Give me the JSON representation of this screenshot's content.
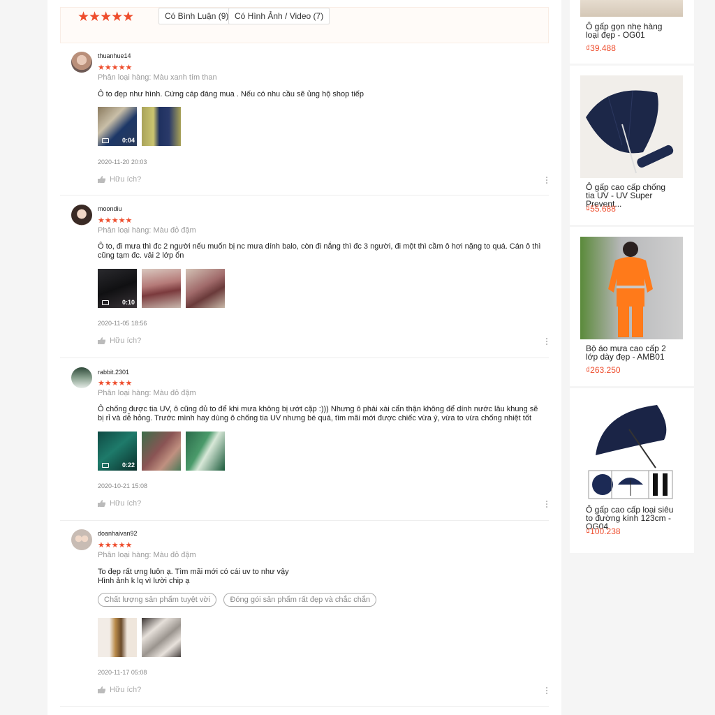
{
  "filters": {
    "stars": "★★★★★",
    "comments_label": "Có Bình Luận (9)",
    "media_label": "Có Hình Ảnh / Video (7)"
  },
  "reviews": [
    {
      "username": "thuanhue14",
      "stars": "★★★★★",
      "variation": "Phân loại hàng: Màu xanh tím than",
      "content": "Ô to đẹp như hình. Cứng cáp đáng mua . Nếu có nhu cầu sẽ ủng hộ shop tiếp",
      "video_duration": "0:04",
      "date": "2020-11-20 20:03",
      "helpful": "Hữu ích?"
    },
    {
      "username": "moondiu",
      "stars": "★★★★★",
      "variation": "Phân loại hàng: Màu đỏ đậm",
      "content": "Ô to, đi mưa thì đc 2 người nếu muốn bị nc mưa dính balo, còn đi nắng thì đc 3 người, đi một thì cầm ô hơi nặng to quá. Cán ô thì cũng tạm đc. vải 2 lớp ổn",
      "video_duration": "0:10",
      "date": "2020-11-05 18:56",
      "helpful": "Hữu ích?"
    },
    {
      "username": "rabbit.2301",
      "stars": "★★★★★",
      "variation": "Phân loại hàng: Màu đỏ đậm",
      "content": "Ô chống được tia UV, ô cũng đủ to để khi mưa không bị ướt cặp :))) Nhưng ô phải xài cẩn thận không để dính nước lâu khung sẽ bị rỉ và dễ hỏng. Trước mình hay dùng ô chống tia UV nhưng bé quá, tìm mãi mới được chiếc vừa ý, vừa to vừa chống nhiệt tốt",
      "video_duration": "0:22",
      "date": "2020-10-21 15:08",
      "helpful": "Hữu ích?"
    },
    {
      "username": "doanhaivan92",
      "stars": "★★★★★",
      "variation": "Phân loại hàng: Màu đỏ đậm",
      "content_line1": "To đẹp rất ưng luôn ạ. Tìm mãi mới có cái uv to như vậy",
      "content_line2": "Hình ảnh k lq vì lười chip ạ",
      "tag1": "Chất lượng sản phẩm tuyệt vời",
      "tag2": "Đóng gói sản phẩm rất đẹp và chắc chắn",
      "date": "2020-11-17 05:08",
      "helpful": "Hữu ích?"
    }
  ],
  "products": [
    {
      "name": "Ô gấp gọn nhẹ hàng loại đẹp - OG01",
      "price": "₫39.488"
    },
    {
      "name": "Ô gấp cao cấp chống tia UV - UV Super Prevent...",
      "price": "₫55.688"
    },
    {
      "name": "Bộ áo mưa cao cấp 2 lớp dày đẹp - AMB01",
      "price": "₫263.250"
    },
    {
      "name": "Ô gấp cao cấp loại siêu to đường kính 123cm - OG04",
      "price": "₫100.238"
    }
  ]
}
